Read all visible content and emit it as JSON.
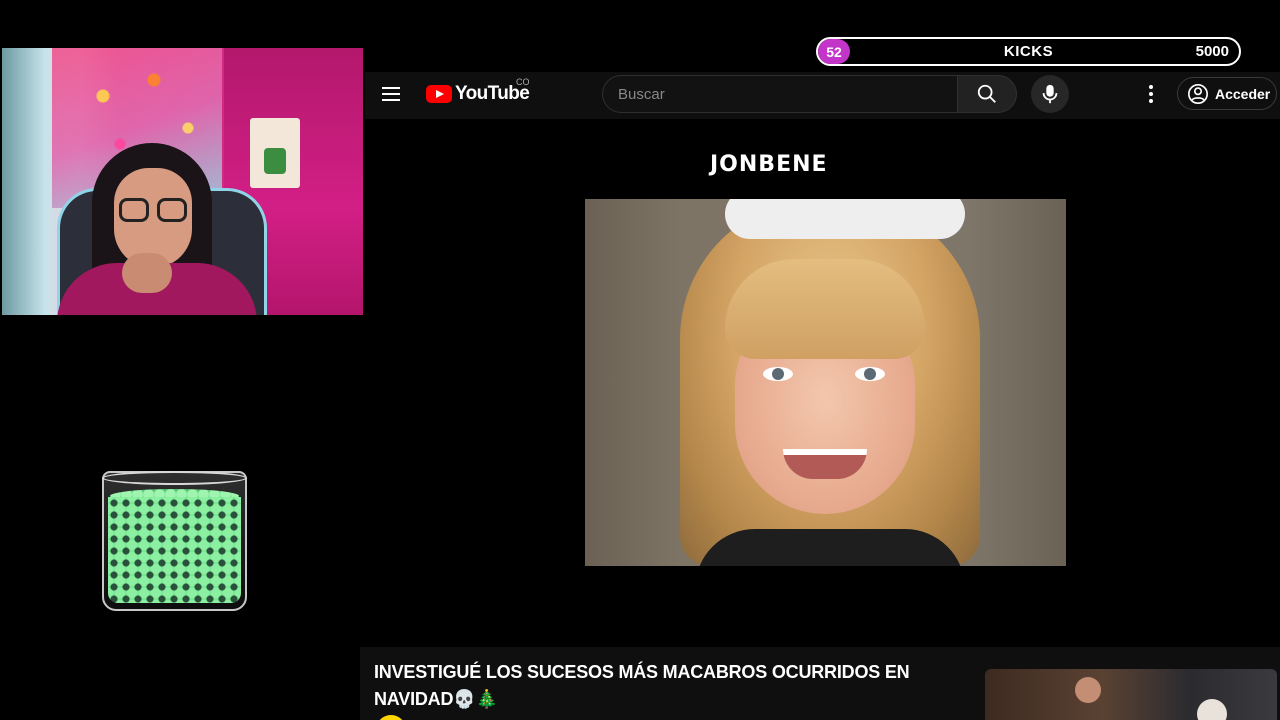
{
  "kicks": {
    "count": "52",
    "label": "KICKS",
    "goal": "5000"
  },
  "youtube": {
    "logo_text": "YouTube",
    "country_code": "CO",
    "search": {
      "placeholder": "Buscar"
    },
    "signin_label": "Acceder"
  },
  "video": {
    "overlay_title": "JONBENE",
    "headline": "INVESTIGUÉ LOS SUCESOS MÁS MACABROS OCURRIDOS EN NAVIDAD💀🎄"
  },
  "icons": [
    "menu-icon",
    "youtube-logo-icon",
    "search-icon",
    "mic-icon",
    "more-vert-icon",
    "account-icon"
  ],
  "colors": {
    "accent": "#ff0000",
    "kicks_badge": "#c335c9",
    "jar_beans": "#6fe38a",
    "header_bg": "#0f0f0f"
  }
}
